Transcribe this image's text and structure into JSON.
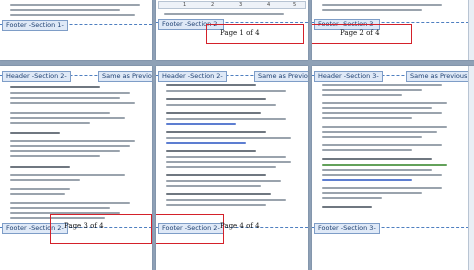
{
  "ruler": {
    "numbers": [
      "1",
      "2",
      "3",
      "4",
      "5"
    ]
  },
  "pages": {
    "p1": {
      "footer_tag": "Footer -Section 1-"
    },
    "p2": {
      "footer_tag": "Footer -Section 2-",
      "page_number": "Page 1 of 4"
    },
    "p3": {
      "footer_tag": "Footer -Section 3-",
      "page_number": "Page 2 of 4"
    },
    "p4": {
      "header_tag": "Header -Section 2-",
      "same_as_previous": "Same as Previous",
      "footer_tag": "Footer -Section 2-",
      "page_number": "Page 3 of 4"
    },
    "p5": {
      "header_tag": "Header -Section 2-",
      "same_as_previous": "Same as Previous",
      "footer_tag": "Footer -Section 2-",
      "page_number": "Page 4 of 4"
    },
    "p6": {
      "header_tag": "Header -Section 3-",
      "same_as_previous": "Same as Previous",
      "footer_tag": "Footer -Section 3-"
    }
  },
  "colors": {
    "red_annotation": "#d4212a",
    "tag_bg": "#dfe9f7",
    "tag_border": "#7e9dc7",
    "workspace": "#8fa1b6"
  }
}
